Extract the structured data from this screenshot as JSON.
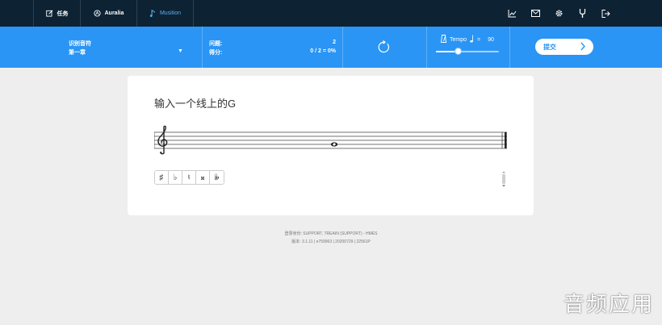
{
  "nav": {
    "tabs": [
      {
        "label": "任务",
        "icon": "edit-icon"
      },
      {
        "label": "Auralia",
        "icon": "auralia-logo-icon"
      },
      {
        "label": "Musition",
        "icon": "musition-logo-icon"
      }
    ],
    "icons": [
      "chart-icon",
      "mail-icon",
      "gear-icon",
      "tuning-fork-icon",
      "logout-icon"
    ]
  },
  "toolbar": {
    "topic": "识别音符",
    "chapter": "第一章",
    "questions_label": "问题:",
    "questions_value": "2",
    "score_label": "得分:",
    "score_value": "0 / 2 = 0%",
    "tempo_label": "Tempo",
    "tempo_eq": "=",
    "tempo_value": "90",
    "tempo_level": 0.35,
    "submit_label": "提交"
  },
  "card": {
    "question": "输入一个线上的G",
    "accidentals": [
      "♯",
      "♭",
      "♮",
      "𝄪",
      "𝄫"
    ]
  },
  "footer": {
    "login_line": "登录身份: SUPPORT, TREAIN (SUPPORT) - HMES",
    "version_line": "版本: 3.1.11 | e759963 | 20200729 | 22561P"
  },
  "watermark": "音频应用",
  "colors": {
    "nav_bg": "#0d2233",
    "accent": "#2a95f5",
    "active_tab": "#5ab0ee"
  }
}
